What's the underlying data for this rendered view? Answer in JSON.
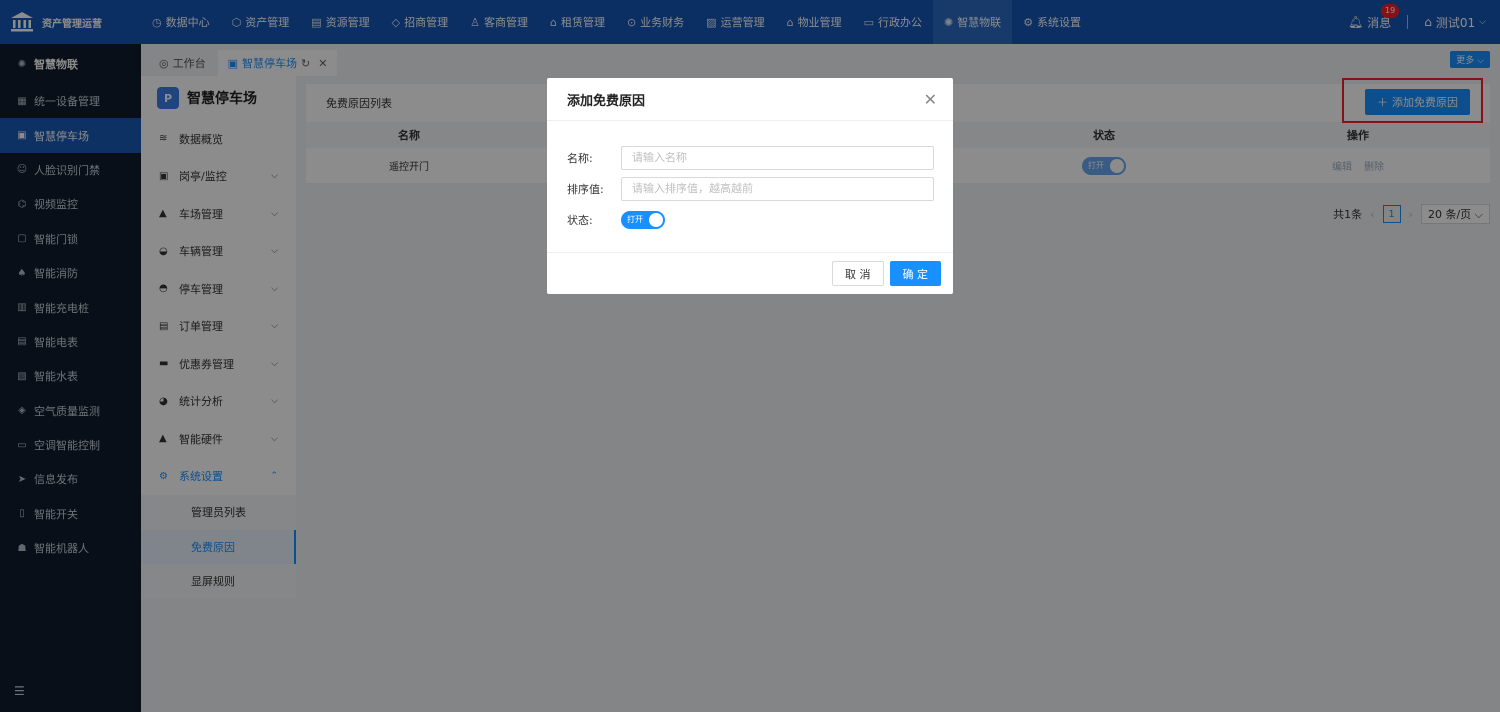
{
  "app": {
    "title": "资产管理运营"
  },
  "topnav": [
    {
      "label": "数据中心",
      "icon": "clock-icon"
    },
    {
      "label": "资产管理",
      "icon": "box-icon"
    },
    {
      "label": "资源管理",
      "icon": "doc-icon"
    },
    {
      "label": "招商管理",
      "icon": "tag-icon"
    },
    {
      "label": "客商管理",
      "icon": "people-icon"
    },
    {
      "label": "租赁管理",
      "icon": "house-icon"
    },
    {
      "label": "业务财务",
      "icon": "money-icon"
    },
    {
      "label": "运营管理",
      "icon": "image-icon"
    },
    {
      "label": "物业管理",
      "icon": "home-icon"
    },
    {
      "label": "行政办公",
      "icon": "monitor-icon"
    },
    {
      "label": "智慧物联",
      "icon": "atom-icon",
      "active": true
    },
    {
      "label": "系统设置",
      "icon": "gear-icon"
    }
  ],
  "topright": {
    "messages": "消息",
    "badge": "19",
    "user": "测试01"
  },
  "sidebar": [
    {
      "label": "智慧物联",
      "icon": "atom-icon"
    },
    {
      "label": "统一设备管理",
      "icon": "grid-icon"
    },
    {
      "label": "智慧停车场",
      "icon": "parking-icon"
    },
    {
      "label": "人脸识别门禁",
      "icon": "face-icon"
    },
    {
      "label": "视频监控",
      "icon": "camera-icon"
    },
    {
      "label": "智能门锁",
      "icon": "lock-icon"
    },
    {
      "label": "智能消防",
      "icon": "fire-icon"
    },
    {
      "label": "智能充电桩",
      "icon": "charger-icon"
    },
    {
      "label": "智能电表",
      "icon": "meter-icon"
    },
    {
      "label": "智能水表",
      "icon": "water-meter-icon"
    },
    {
      "label": "空气质量监测",
      "icon": "air-icon"
    },
    {
      "label": "空调智能控制",
      "icon": "ac-icon"
    },
    {
      "label": "信息发布",
      "icon": "send-icon"
    },
    {
      "label": "智能开关",
      "icon": "switch-icon"
    },
    {
      "label": "智能机器人",
      "icon": "robot-icon"
    }
  ],
  "tabs": [
    {
      "label": "工作台"
    },
    {
      "label": "智慧停车场"
    }
  ],
  "more_label": "更多",
  "submenu": {
    "title": "智慧停车场",
    "logo_letter": "P",
    "items": [
      {
        "label": "数据概览"
      },
      {
        "label": "岗亭/监控"
      },
      {
        "label": "车场管理"
      },
      {
        "label": "车辆管理"
      },
      {
        "label": "停车管理"
      },
      {
        "label": "订单管理"
      },
      {
        "label": "优惠券管理"
      },
      {
        "label": "统计分析"
      },
      {
        "label": "智能硬件"
      },
      {
        "label": "系统设置"
      }
    ],
    "children": [
      {
        "label": "管理员列表"
      },
      {
        "label": "免费原因"
      },
      {
        "label": "显屏规则"
      }
    ]
  },
  "panel": {
    "title": "免费原因列表",
    "add_button": "添加免费原因",
    "columns": [
      "名称",
      "",
      "",
      "状态",
      "操作"
    ],
    "rows": [
      {
        "name": "遥控开门",
        "status": "打开",
        "edit": "编辑",
        "delete": "删除"
      }
    ]
  },
  "pager": {
    "total": "共1条",
    "page": "1",
    "size": "20 条/页"
  },
  "modal": {
    "title": "添加免费原因",
    "name_label": "名称:",
    "name_placeholder": "请输入名称",
    "order_label": "排序值:",
    "order_placeholder": "请输入排序值，越高越前",
    "status_label": "状态:",
    "status_value": "打开",
    "cancel": "取 消",
    "ok": "确 定"
  },
  "colors": {
    "primary": "#1890ff",
    "topbar": "#1657b4",
    "sidebar": "#111c2e",
    "highlight": "#f5222d"
  }
}
